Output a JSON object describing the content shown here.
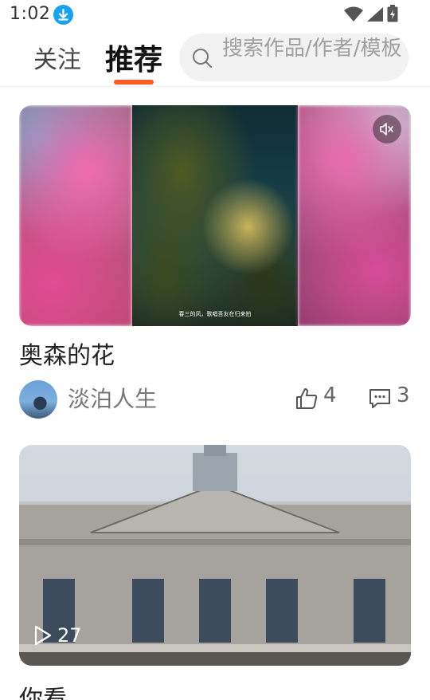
{
  "status_bar": {
    "time": "1:02"
  },
  "header": {
    "tabs": [
      {
        "label": "关注",
        "active": false
      },
      {
        "label": "推荐",
        "active": true
      }
    ],
    "search": {
      "placeholder": "搜索作品/作者/模板"
    },
    "accent_color": "#ff5a1f"
  },
  "feed": [
    {
      "title": "奥森的花",
      "subtitle": "春三的风，歌唱吾友在归来拍",
      "author": "淡泊人生",
      "likes": "4",
      "comments": "3",
      "muted": true
    },
    {
      "title": "你看",
      "plays": "27"
    }
  ],
  "icons": [
    "download-icon",
    "wifi-icon",
    "signal-icon",
    "battery-icon",
    "search-icon",
    "mute-icon",
    "like-icon",
    "comment-icon",
    "play-icon"
  ]
}
